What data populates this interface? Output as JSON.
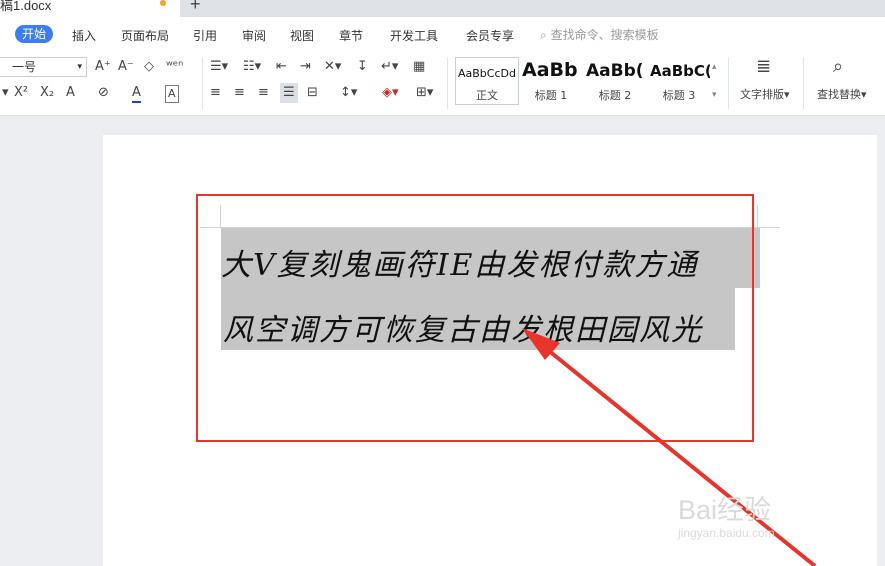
{
  "tab": {
    "title": "稿1.docx",
    "new_tab": "+"
  },
  "menu": {
    "items": [
      "开始",
      "插入",
      "页面布局",
      "引用",
      "审阅",
      "视图",
      "章节",
      "开发工具",
      "会员专享"
    ],
    "search_placeholder": "查找命令、搜索模板"
  },
  "toolbar": {
    "font_size": "一号",
    "row1": [
      "A⁺",
      "A⁻",
      "◇",
      "ʷᵉⁿ"
    ],
    "row2": [
      "X²",
      "X₂",
      "A",
      "⊘",
      "A",
      "A"
    ],
    "text_layout_label": "文字排版",
    "find_replace_label": "查找替换"
  },
  "styles": [
    {
      "sample": "AaBbCcDd",
      "name": "正文"
    },
    {
      "sample": "AaBb",
      "name": "标题 1"
    },
    {
      "sample": "AaBb(",
      "name": "标题 2"
    },
    {
      "sample": "AaBbC(",
      "name": "标题 3"
    }
  ],
  "document": {
    "line1": "  大Ⅴ复刻鬼画符IE由发根付款方通",
    "line2": "风空调方可恢复古由发根田园风光"
  },
  "watermark": {
    "text": "Bai经验",
    "sub": "jingyan.baidu.com"
  },
  "colors": {
    "accent": "#3d7df3",
    "annotation_red": "#e8342b",
    "selection": "#c6c6c6"
  }
}
